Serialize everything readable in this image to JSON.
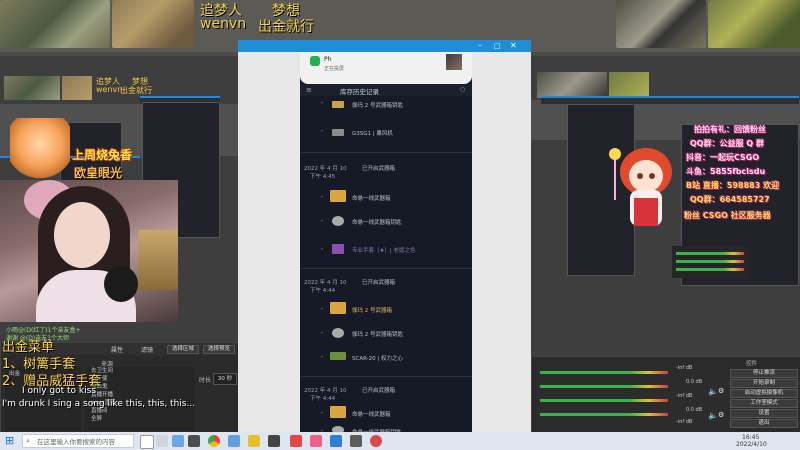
{
  "top": {
    "title_left": "追梦人",
    "subtitle_left": "wenvn",
    "title_right": "梦想",
    "subtitle_right": "出金就行"
  },
  "nested_top": {
    "title_left": "追梦人",
    "subtitle_left": "wenvn",
    "title_right": "梦想",
    "subtitle_right": "出金就行"
  },
  "left_overlay": {
    "sticker_line1": "上周烧兔香",
    "sticker_line2": "欧皇眼光",
    "chat_line1": "小雨@(D(红了)1个亲友盒+",
    "chat_line2": "谢谢 @(D)亲友1个大师",
    "menu_title": "出金菜单",
    "menu_item1": "1、树篱手套",
    "menu_item2": "2、赠品威猛手套",
    "lyric1": "I only got to kiss",
    "lyric2": "I'm drunk I sing a song like this, this, this..."
  },
  "left_panel": {
    "sources_header": "来源",
    "scene_label": "出金",
    "items": [
      "去卫生间",
      "小天使",
      "吸血鬼",
      "直播开播",
      "ayen直播",
      "直播间",
      "全屏"
    ],
    "btn_properties": "属性",
    "btn_filters": "滤镜",
    "btn_settings": "选择区域",
    "btn_settings2": "选择预览",
    "time_label": "时长",
    "time_value": "30 秒"
  },
  "phone": {
    "notif_app": "Ph",
    "notif_sub": "正在投屏",
    "header": "库存历史记录",
    "sections": [
      {
        "date": "",
        "status": "",
        "sub": "",
        "items": [
          {
            "name": "伽玛 2 号武器箱钥匙",
            "icon_color": "#c9a24a"
          },
          {
            "name": "G3SG1 | 暴风机",
            "icon_color": "#8c8c8c"
          }
        ]
      },
      {
        "date": "2022 年 4 月 10",
        "status": "已开启武器箱",
        "sub": "下午 4:45",
        "items": [
          {
            "name": "命悬一线武器箱",
            "icon_color": "#d9a441"
          },
          {
            "name": "命悬一线武器箱钥匙",
            "icon_color": "#aaaaaa"
          },
          {
            "name": "专业手套（★）| 老版之色",
            "icon_color": "#8e4fb0"
          }
        ]
      },
      {
        "date": "2022 年 4 月 10",
        "status": "已开启武器箱",
        "sub": "下午 4:44",
        "items": [
          {
            "name": "伽玛 2 号武器箱",
            "icon_color": "#d9a441"
          },
          {
            "name": "伽玛 2 号武器箱钥匙",
            "icon_color": "#aaaaaa"
          },
          {
            "name": "SCAR-20 | 权力之心",
            "icon_color": "#6d8f3e"
          }
        ]
      },
      {
        "date": "2022 年 4 月 10",
        "status": "已开启武器箱",
        "sub": "下午 4:44",
        "items": [
          {
            "name": "命悬一线武器箱",
            "icon_color": "#d9a441"
          },
          {
            "name": "命悬一线武器箱钥匙",
            "icon_color": "#aaaaaa"
          }
        ]
      }
    ]
  },
  "right_overlay": {
    "line1": "拍拍有礼：回馈粉丝",
    "line2": "QQ群：公益服 Q 群",
    "line3": "抖音：一起玩CSGO",
    "line4": "斗鱼：5855fbclsdu",
    "line5": "B站 直播：598883 欢迎",
    "line6": "QQ群：664585727",
    "line7": "粉丝 CSGO 社区服务器"
  },
  "right_panel": {
    "controls_header": "控件",
    "btn_start_stream": "停止推流",
    "btn_start_record": "开始录制",
    "btn_virtual_cam": "启动虚拟摄像机",
    "btn_studio": "工作室模式",
    "btn_settings": "设置",
    "btn_exit": "退出",
    "db_values": [
      "-inf dB",
      "0.0 dB",
      "-inf dB",
      "0.0 dB",
      "-inf dB"
    ]
  },
  "taskbar": {
    "search_placeholder": "在这里输入你要搜索的内容",
    "time": "16:45",
    "date": "2022/4/10"
  }
}
